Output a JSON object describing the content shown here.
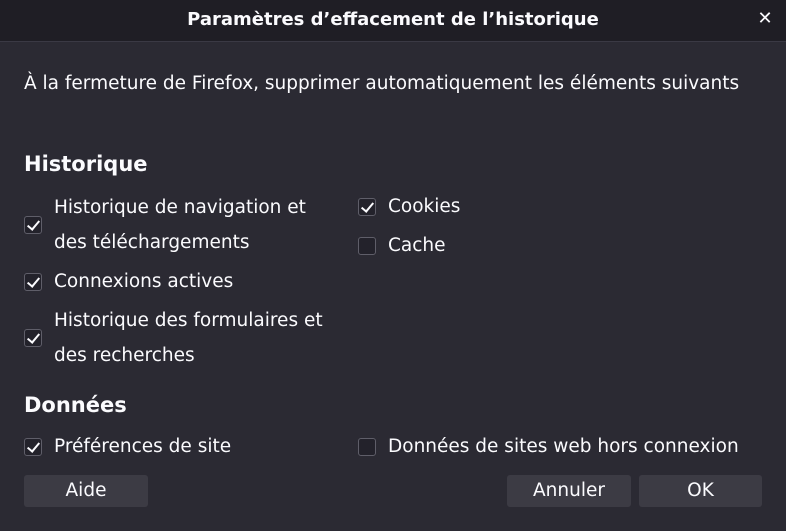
{
  "dialog": {
    "title": "Paramètres d’effacement de l’historique",
    "close_glyph": "✕",
    "description": "À la fermeture de Firefox, supprimer automatiquement les éléments suivants"
  },
  "history": {
    "heading": "Historique",
    "items": [
      {
        "label_line1": "Historique de navigation et",
        "label_line2": "des téléchargements",
        "checked": true
      },
      {
        "label": "Connexions actives",
        "checked": true
      },
      {
        "label_line1": "Historique des formulaires et",
        "label_line2": "des recherches",
        "checked": true
      },
      {
        "label": "Cookies",
        "checked": true
      },
      {
        "label": "Cache",
        "checked": false
      }
    ]
  },
  "data_section": {
    "heading": "Données",
    "items": [
      {
        "label": "Préférences de site",
        "checked": true
      },
      {
        "label": "Données de sites web hors connexion",
        "checked": false
      }
    ]
  },
  "buttons": {
    "help": "Aide",
    "cancel": "Annuler",
    "ok": "OK"
  },
  "colors": {
    "background": "#2b2a33",
    "titlebar": "#1f1e25",
    "text": "#fbfbfe",
    "button": "#3c3b44"
  }
}
